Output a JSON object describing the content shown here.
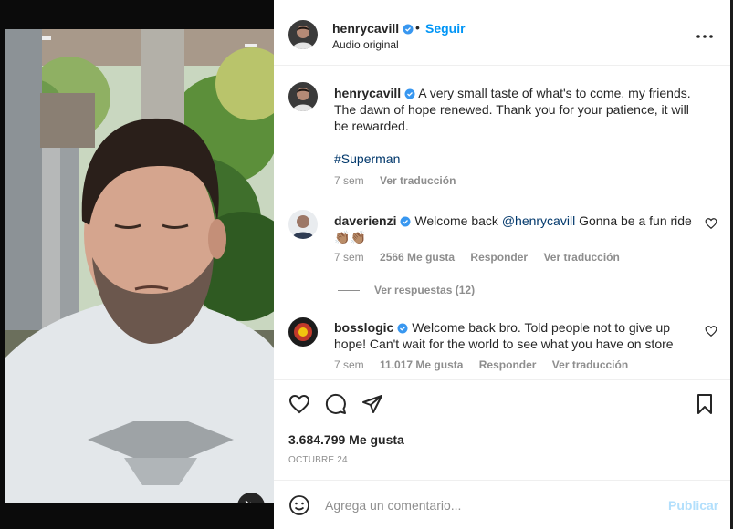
{
  "post": {
    "username": "henrycavill",
    "dot": "•",
    "follow_label": "Seguir",
    "audio_label": "Audio original",
    "caption": "A very small taste of what's to come, my friends. The dawn of hope renewed. Thank you for your patience, it will be rewarded.",
    "hashtag": "#Superman",
    "caption_time": "7 sem",
    "caption_translate": "Ver traducción"
  },
  "comments": [
    {
      "username": "daverienzi",
      "text_before": "Welcome back ",
      "mention": "@henrycavill",
      "text_after": " Gonna be a fun ride",
      "emoji": "👏🏽",
      "time": "7 sem",
      "likes": "2566 Me gusta",
      "reply": "Responder",
      "translate": "Ver traducción",
      "view_replies": "Ver respuestas (12)"
    },
    {
      "username": "bosslogic",
      "text": "Welcome back bro. Told people not to give up hope! Can't wait for the world to see what you have on store",
      "time": "7 sem",
      "likes": "11.017 Me gusta",
      "reply": "Responder",
      "translate": "Ver traducción"
    }
  ],
  "footer": {
    "likes_count": "3.684.799 Me gusta",
    "date": "OCTUBRE 24",
    "comment_placeholder": "Agrega un comentario...",
    "publish_label": "Publicar"
  },
  "icons": {
    "verified": "verified-badge-icon",
    "more": "more-options-icon",
    "heart": "heart-icon",
    "comment": "comment-icon",
    "share": "share-icon",
    "save": "bookmark-icon",
    "emoji": "emoji-icon",
    "mute": "muted-speaker-icon"
  },
  "colors": {
    "accent": "#0095f6",
    "verified": "#3897f0",
    "link": "#00376b",
    "muted": "#8e8e8e"
  }
}
